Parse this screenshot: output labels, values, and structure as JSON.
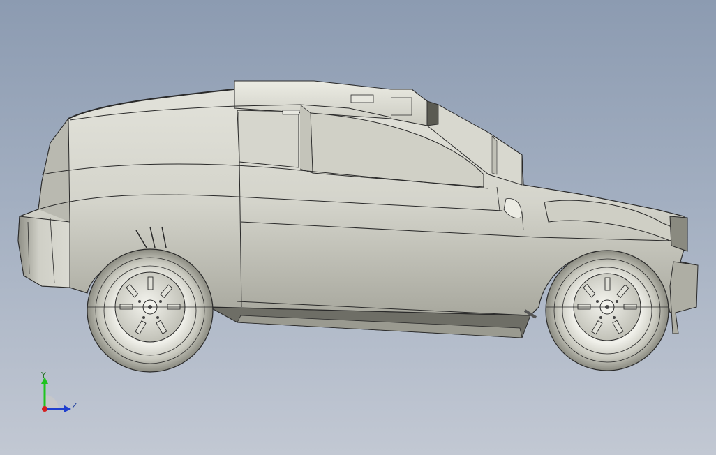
{
  "view": {
    "background_top": "#8c9bb1",
    "background_bottom": "#c2c8d3",
    "model_fill": "#dcdcd2",
    "model_edge": "#2a2a2a"
  },
  "triad": {
    "y_label": "Y",
    "z_label": "Z",
    "y_color": "#1fc41f",
    "z_color": "#1f3fcf",
    "x_color": "#d42020"
  }
}
